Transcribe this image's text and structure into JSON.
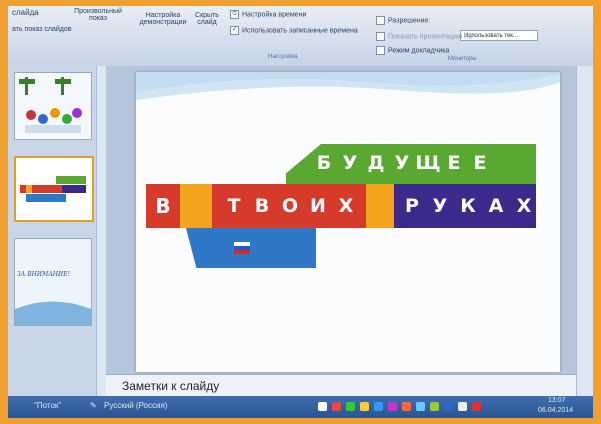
{
  "ribbon": {
    "item_slide": "слайда",
    "item_show_slides": "ать показ слайдов",
    "item_custom_show": "Произвольный показ",
    "item_setup": "Настройка демонстрации",
    "item_hide": "Скрыть слайд",
    "item_timings": "Настройка времени",
    "item_use_timings": "Использовать записанные времена",
    "group_setup": "Настройка",
    "item_resolution": "Разрешение:",
    "item_show_on": "Показать презентацию на:",
    "item_presenter": "Режим докладчика",
    "resolution_value": "Использовать тек...",
    "group_monitors": "Мониторы"
  },
  "thumbnails": {
    "thumb3_text": "ЗА ВНИМАНИЕ!"
  },
  "slide": {
    "word_future": [
      "Б",
      "У",
      "Д",
      "У",
      "Щ",
      "Е",
      "Е"
    ],
    "word_in": "В",
    "word_your": [
      "Т",
      "В",
      "О",
      "И",
      "Х"
    ],
    "word_hands": [
      "Р",
      "У",
      "К",
      "А",
      "Х"
    ]
  },
  "notes": {
    "label": "Заметки к слайду"
  },
  "taskbar": {
    "left_label": "\"Поток\"",
    "language": "Русский (Россия)",
    "time": "13:07",
    "date": "06.04.2014"
  },
  "colors": {
    "bezel": "#f0a030",
    "ribbon": "#dfe7f2",
    "green": "#5aa832",
    "red": "#d63a2a",
    "orange": "#f5a31c",
    "purple": "#3b2a8c",
    "blue": "#2f78c8"
  }
}
